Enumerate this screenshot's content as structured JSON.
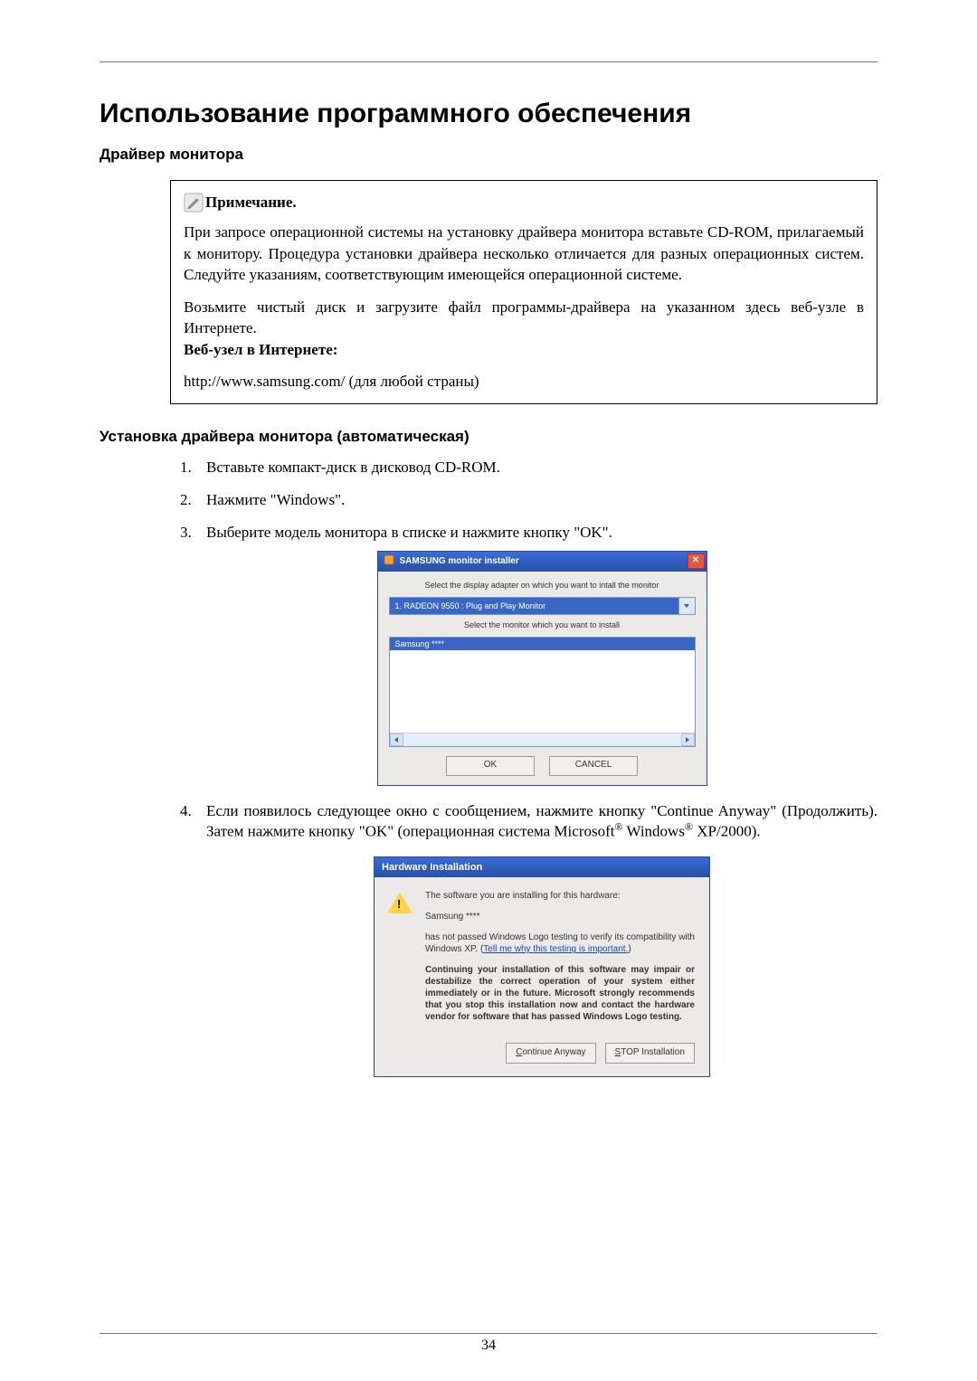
{
  "doc": {
    "main_title": "Использование программного обеспечения",
    "section_driver": "Драйвер монитора",
    "note_label": "Примечание.",
    "note_p1": "При запросе операционной системы на установку драйвера монитора вставьте CD-ROM, прилагаемый к монитору. Процедура установки драйвера несколько отличается для разных операционных систем. Следуйте указаниям, соответствующим имеющейся операционной системе.",
    "note_p2": "Возьмите чистый диск и загрузите файл программы-драйвера на указанном здесь веб-узле в Интернете.",
    "note_website_label": "Веб-узел в Интернете:",
    "note_url": "http://www.samsung.com/",
    "note_url_tail": " (для любой страны)",
    "section_install_auto": "Установка драйвера монитора (автоматическая)",
    "steps": {
      "s1": "Вставьте компакт-диск в дисковод CD-ROM.",
      "s2": "Нажмите \"Windows\".",
      "s3": "Выберите модель монитора в списке и нажмите кнопку \"OK\".",
      "s4_a": "Если появилось следующее окно с сообщением, нажмите кнопку \"Continue Anyway\" (Продолжить). Затем нажмите кнопку \"OK\" (операционная система Microsoft",
      "s4_b": " Windows",
      "s4_c": " XP/2000)."
    },
    "page_number": "34"
  },
  "dlg1": {
    "title": "SAMSUNG monitor installer",
    "prompt1": "Select the display adapter on which you want to intall the monitor",
    "combo_value": "1. RADEON 9550 : Plug and Play Monitor",
    "prompt2": "Select the monitor which you want to install",
    "list_sel": "Samsung ****",
    "btn_ok": "OK",
    "btn_cancel": "CANCEL"
  },
  "dlg2": {
    "title": "Hardware Installation",
    "p1": "The software you are installing for this hardware:",
    "p2": "Samsung ****",
    "p3a": "has not passed Windows Logo testing to verify its compatibility with Windows XP. (",
    "p3_link": "Tell me why this testing is important.",
    "p3b": ")",
    "p4": "Continuing your installation of this software may impair or destabilize the correct operation of your system either immediately or in the future. Microsoft strongly recommends that you stop this installation now and contact the hardware vendor for software that has passed Windows Logo testing.",
    "btn_continue": "Continue Anyway",
    "btn_stop": "STOP Installation"
  }
}
